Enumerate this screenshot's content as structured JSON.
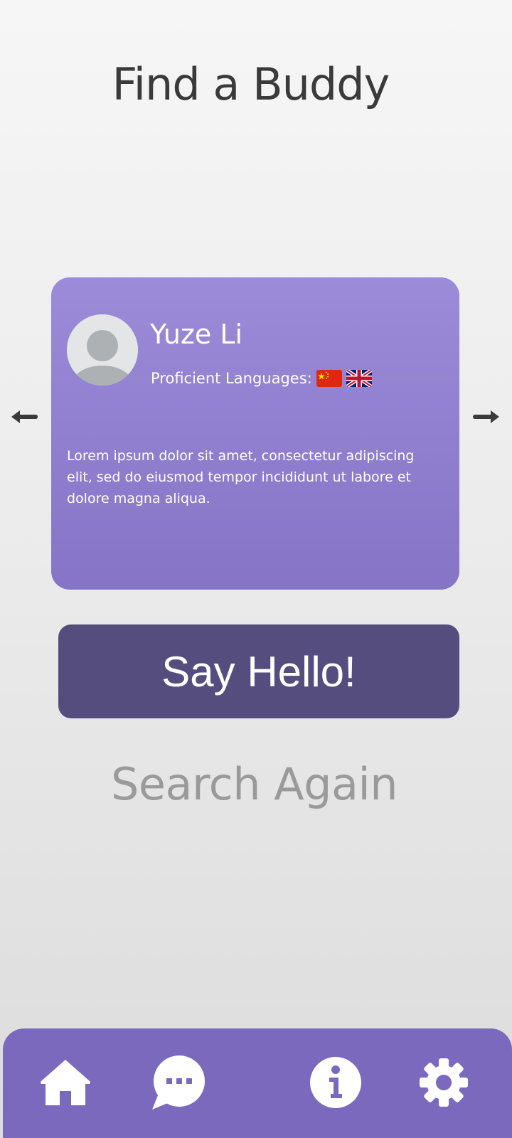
{
  "header": {
    "title": "Find a Buddy"
  },
  "profile": {
    "name": "Yuze Li",
    "languages_label": "Proficient Languages:",
    "languages": [
      "cn-flag-icon",
      "uk-flag-icon"
    ],
    "bio": "Lorem ipsum dolor sit amet, consectetur adipiscing elit, sed do eiusmod tempor incididunt ut labore et dolore magna aliqua."
  },
  "actions": {
    "hello_label": "Say Hello!",
    "search_again_label": "Search Again"
  },
  "nav": {
    "items": [
      "home-icon",
      "chat-icon",
      "info-icon",
      "gear-icon"
    ]
  },
  "colors": {
    "card": "#9b8bd8",
    "button": "#564d7f",
    "navbar": "#7b69bd"
  }
}
